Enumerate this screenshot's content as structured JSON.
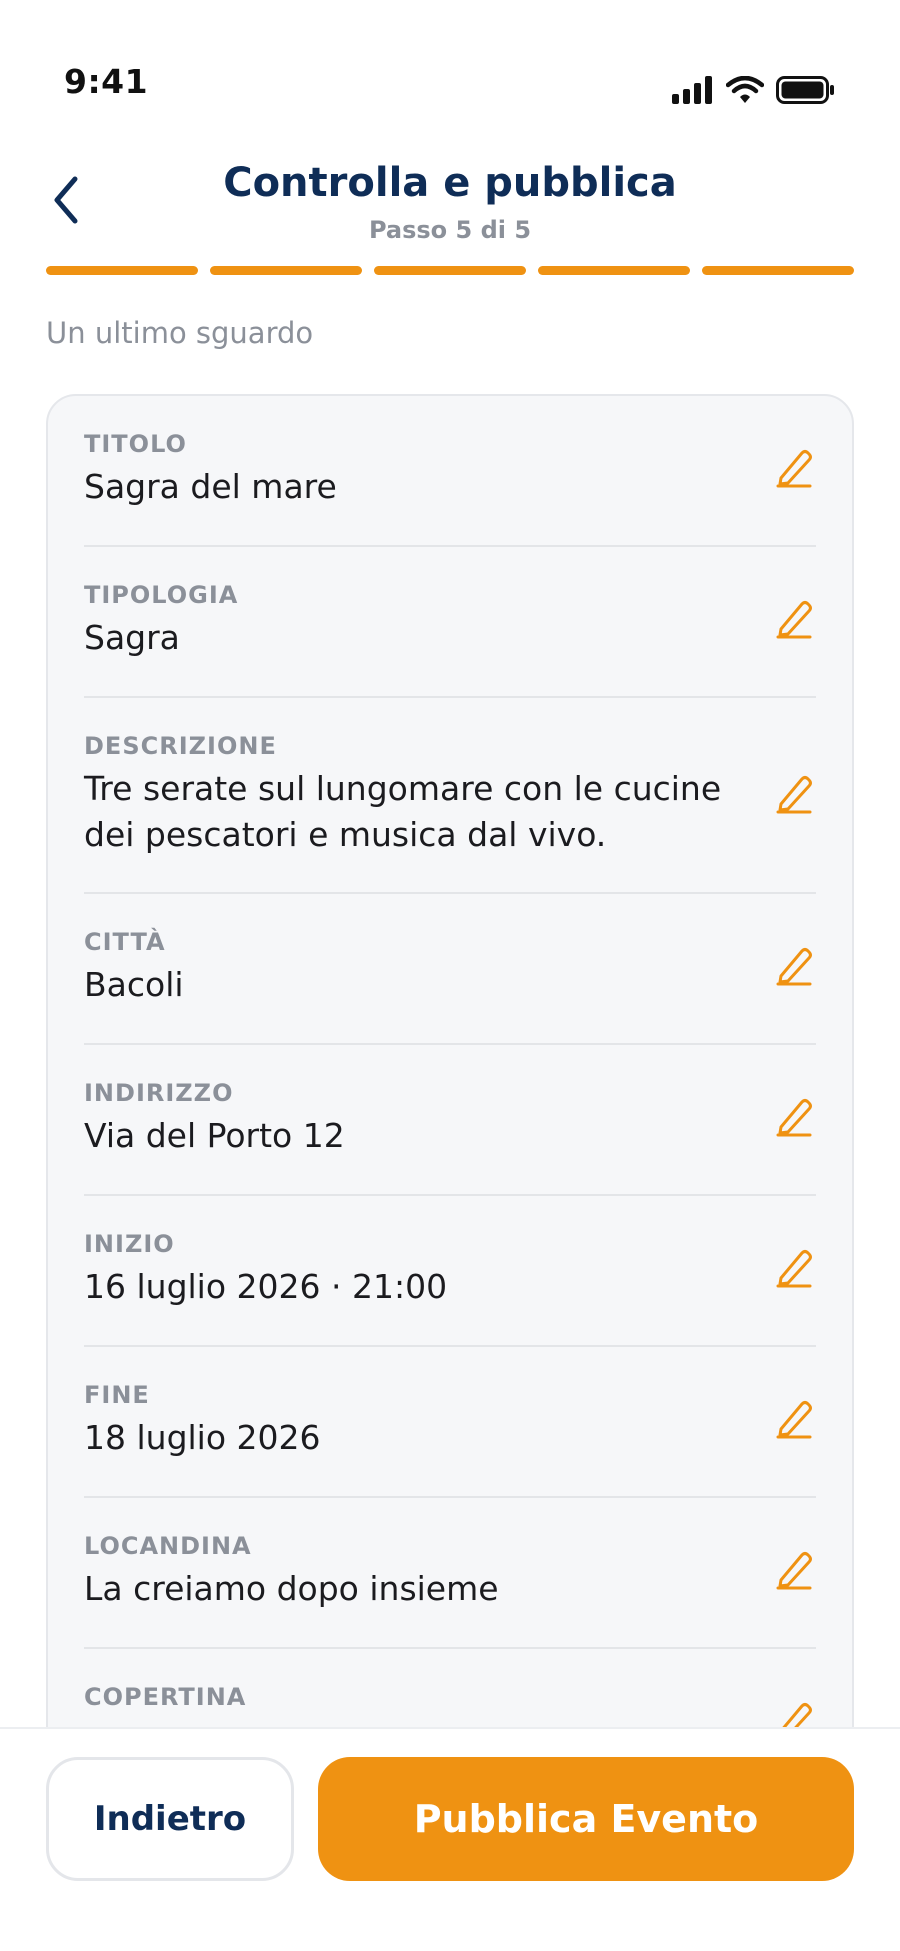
{
  "status_bar": {
    "time": "9:41"
  },
  "header": {
    "title": "Controlla e pubblica",
    "step": "Passo 5 di 5"
  },
  "progress": {
    "current_step": 5,
    "total_steps": 5
  },
  "intro": "Un ultimo sguardo",
  "review": {
    "items": [
      {
        "label": "TITOLO",
        "value": "Sagra del mare"
      },
      {
        "label": "TIPOLOGIA",
        "value": "Sagra"
      },
      {
        "label": "DESCRIZIONE",
        "value": "Tre serate sul lungomare con le cucine dei pescatori e musica dal vivo."
      },
      {
        "label": "CITTÀ",
        "value": "Bacoli"
      },
      {
        "label": "INDIRIZZO",
        "value": "Via del Porto 12"
      },
      {
        "label": "INIZIO",
        "value": "16 luglio 2026 · 21:00"
      },
      {
        "label": "FINE",
        "value": "18 luglio 2026"
      },
      {
        "label": "LOCANDINA",
        "value": "La creiamo dopo insieme"
      },
      {
        "label": "COPERTINA",
        "value": ""
      }
    ]
  },
  "footer": {
    "back_label": "Indietro",
    "publish_label": "Pubblica Evento"
  },
  "colors": {
    "accent": "#ef9212",
    "title": "#0f2d57",
    "muted": "#8b9099"
  }
}
